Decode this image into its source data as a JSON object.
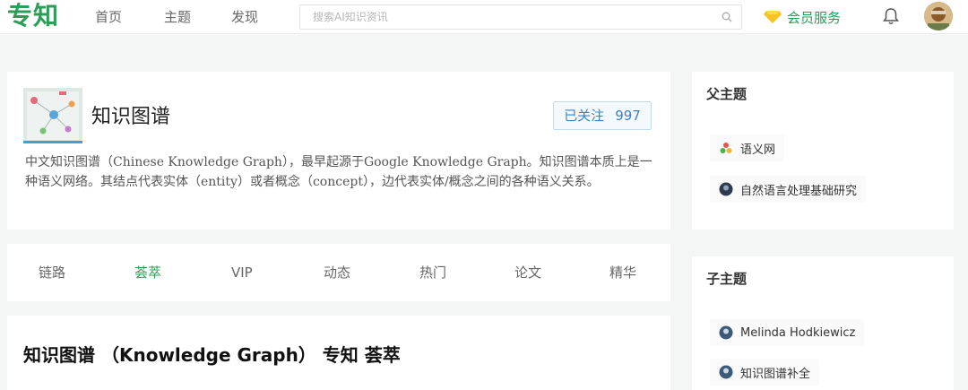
{
  "header": {
    "logo": "专知",
    "nav": [
      "首页",
      "主题",
      "发现"
    ],
    "search_placeholder": "搜索AI知识资讯",
    "vip_label": "会员服务"
  },
  "topic": {
    "title": "知识图谱",
    "follow_label": "已关注",
    "follow_count": "997",
    "description": "中文知识图谱（Chinese Knowledge Graph），最早起源于Google Knowledge Graph。知识图谱本质上是一种语义网络。其结点代表实体（entity）或者概念（concept），边代表实体/概念之间的各种语义关系。"
  },
  "tabs": {
    "items": [
      "链路",
      "荟萃",
      "VIP",
      "动态",
      "热门",
      "论文",
      "精华"
    ],
    "active": "荟萃"
  },
  "content": {
    "title": "知识图谱 （Knowledge Graph） 专知 荟萃"
  },
  "sidebar": {
    "parent_title": "父主题",
    "parent_items": [
      {
        "label": "语义网",
        "icon": "semantic-web-icon"
      },
      {
        "label": "自然语言处理基础研究",
        "icon": "nlp-icon"
      }
    ],
    "child_title": "子主题",
    "child_items": [
      {
        "label": "Melinda Hodkiewicz",
        "icon": "person-icon"
      },
      {
        "label": "知识图谱补全",
        "icon": "kg-completion-icon"
      }
    ]
  },
  "colors": {
    "brand": "#2a9d57",
    "follow": "#3b82c4"
  }
}
